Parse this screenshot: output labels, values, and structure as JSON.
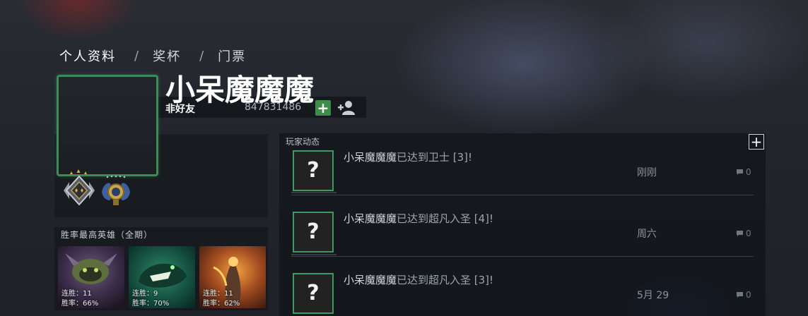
{
  "nav": {
    "tabs": [
      {
        "label": "个人资料"
      },
      {
        "label": "奖杯"
      },
      {
        "label": "门票"
      }
    ],
    "separator": "/"
  },
  "profile": {
    "name": "小呆魔魔魔",
    "friend_status": "非好友",
    "friend_id": "847831486",
    "add_button": "+"
  },
  "top_heroes": {
    "title": "胜率最高英雄（全期）",
    "heroes": [
      {
        "streak": "连胜：11",
        "winrate": "胜率：66%"
      },
      {
        "streak": "连胜：9",
        "winrate": "胜率：70%"
      },
      {
        "streak": "连胜：11",
        "winrate": "胜率：62%"
      }
    ]
  },
  "feed": {
    "title": "玩家动态",
    "add_button": "+",
    "items": [
      {
        "icon": "?",
        "who": "小呆魔魔魔",
        "what": "已达到卫士 [3]!",
        "time": "刚刚",
        "comments": "0"
      },
      {
        "icon": "?",
        "who": "小呆魔魔魔",
        "what": "已达到超凡入圣 [4]!",
        "time": "周六",
        "comments": "0"
      },
      {
        "icon": "?",
        "who": "小呆魔魔魔",
        "what": "已达到超凡入圣 [3]!",
        "time": "5月 29",
        "comments": "0"
      }
    ]
  },
  "colors": {
    "accent_green": "#3e8c4a",
    "frame_green": "#3f8a5a"
  }
}
